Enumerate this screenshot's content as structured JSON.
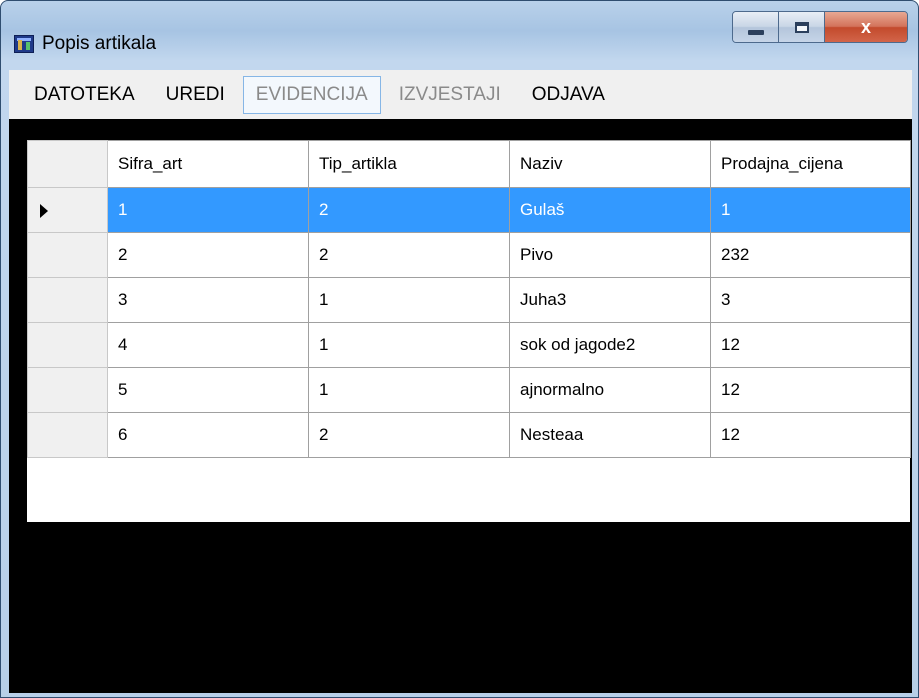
{
  "window": {
    "title": "Popis artikala",
    "controls": {
      "minimize": "minimize-icon",
      "maximize": "maximize-icon",
      "close_glyph": "x"
    }
  },
  "menu": {
    "items": [
      {
        "label": "DATOTEKA",
        "enabled": true
      },
      {
        "label": "UREDI",
        "enabled": true
      },
      {
        "label": "EVIDENCIJA",
        "enabled": false,
        "highlighted": true
      },
      {
        "label": "IZVJESTAJI",
        "enabled": false
      },
      {
        "label": "ODJAVA",
        "enabled": true
      }
    ]
  },
  "grid": {
    "columns": [
      "Sifra_art",
      "Tip_artikla",
      "Naziv",
      "Prodajna_cijena"
    ],
    "rows": [
      [
        "1",
        "2",
        "Gulaš",
        "1"
      ],
      [
        "2",
        "2",
        "Pivo",
        "232"
      ],
      [
        "3",
        "1",
        "Juha3",
        "3"
      ],
      [
        "4",
        "1",
        "sok od jagode2",
        "12"
      ],
      [
        "5",
        "1",
        "ajnormalno",
        "12"
      ],
      [
        "6",
        "2",
        "Nesteaa",
        "12"
      ]
    ],
    "selected_row": 0,
    "current_row_indicator": "arrow-right-icon",
    "selection_color": "#3399ff"
  }
}
